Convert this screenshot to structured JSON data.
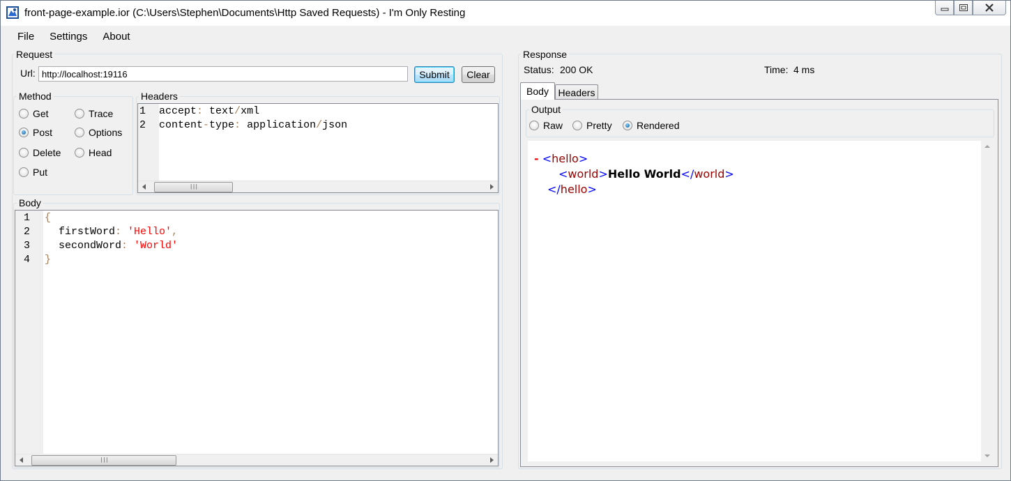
{
  "window": {
    "title": "front-page-example.ior (C:\\Users\\Stephen\\Documents\\Http Saved Requests) - I'm Only Resting"
  },
  "menu": {
    "file": "File",
    "settings": "Settings",
    "about": "About"
  },
  "request": {
    "group_label": "Request",
    "url_label": "Url:",
    "url_value": "http://localhost:19116",
    "submit_label": "Submit",
    "clear_label": "Clear",
    "method": {
      "group_label": "Method",
      "options": [
        "Get",
        "Trace",
        "Post",
        "Options",
        "Delete",
        "Head",
        "Put"
      ],
      "selected": "Post"
    },
    "headers": {
      "group_label": "Headers",
      "line_numbers": [
        "1",
        "2"
      ],
      "lines": [
        {
          "key": "accept",
          "sep": ":",
          "v1": " text",
          "slash": "/",
          "v2": "xml"
        },
        {
          "key": "content",
          "dash": "-",
          "key2": "type",
          "sep": ":",
          "v1": " application",
          "slash": "/",
          "v2": "json"
        }
      ]
    },
    "body": {
      "group_label": "Body",
      "line_numbers": [
        "1",
        "2",
        "3",
        "4"
      ],
      "open_brace": "{",
      "close_brace": "}",
      "lines": [
        {
          "key": "firstWord",
          "colon": ":",
          "value": "'Hello'",
          "comma": ","
        },
        {
          "key": "secondWord",
          "colon": ":",
          "value": "'World'"
        }
      ]
    }
  },
  "response": {
    "group_label": "Response",
    "status_label": "Status:",
    "status_value": "200 OK",
    "time_label": "Time:",
    "time_value": "4 ms",
    "tabs": [
      "Body",
      "Headers"
    ],
    "active_tab": "Body",
    "output": {
      "group_label": "Output",
      "options": [
        "Raw",
        "Pretty",
        "Rendered"
      ],
      "selected": "Rendered"
    },
    "rendered": {
      "collapse_marker": "-",
      "lt": "<",
      "gt": ">",
      "lt_slash": "</",
      "outer_tag": "hello",
      "inner_tag": "world",
      "inner_text": "Hello World"
    }
  },
  "colors": {
    "code_key": "#000000",
    "code_punct": "#a67f59",
    "code_string": "#ff0000",
    "xml_bracket": "#0000ff",
    "xml_name": "#990000"
  }
}
